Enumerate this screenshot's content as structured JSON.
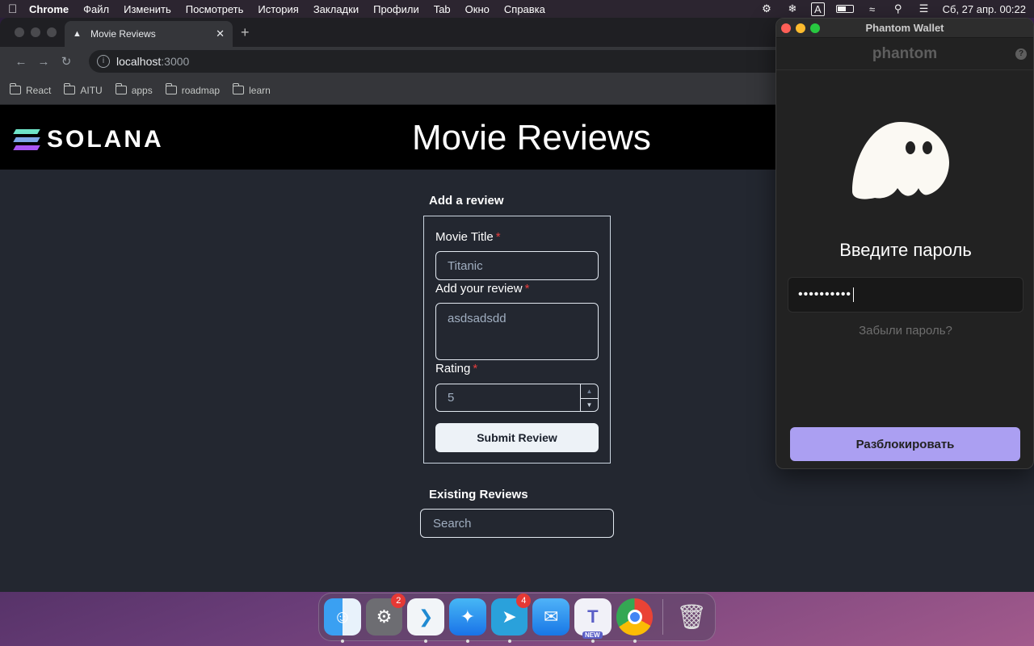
{
  "menubar": {
    "app": "Chrome",
    "items": [
      "Файл",
      "Изменить",
      "Посмотреть",
      "История",
      "Закладки",
      "Профили",
      "Tab",
      "Окно",
      "Справка"
    ],
    "input_indicator": "A",
    "datetime": "Сб, 27 апр.  00:22"
  },
  "browser": {
    "tab_title": "Movie Reviews",
    "url_host": "localhost",
    "url_port": ":3000",
    "bookmarks": [
      "React",
      "AITU",
      "apps",
      "roadmap",
      "learn"
    ]
  },
  "site": {
    "brand": "SOLANA",
    "title": "Movie Reviews",
    "form_heading": "Add a review",
    "fields": {
      "title_label": "Movie Title",
      "title_value": "Titanic",
      "review_label": "Add your review",
      "review_value": "asdsadsdd",
      "rating_label": "Rating",
      "rating_value": "5",
      "required_mark": "*"
    },
    "submit_label": "Submit Review",
    "existing_heading": "Existing Reviews",
    "search_placeholder": "Search"
  },
  "phantom": {
    "window_title": "Phantom Wallet",
    "brand": "phantom",
    "help": "?",
    "heading": "Введите пароль",
    "password_mask": "••••••••••",
    "forgot": "Забыли пароль?",
    "unlock": "Разблокировать",
    "accent": "#ab9ff2"
  },
  "dock": {
    "apps": [
      {
        "name": "Finder",
        "icon": "finder-icon"
      },
      {
        "name": "System Settings",
        "icon": "settings-icon",
        "badge": "2"
      },
      {
        "name": "VS Code",
        "icon": "vscode-icon"
      },
      {
        "name": "Safari",
        "icon": "safari-icon"
      },
      {
        "name": "Telegram",
        "icon": "telegram-icon",
        "badge": "4"
      },
      {
        "name": "Mail",
        "icon": "mail-icon"
      },
      {
        "name": "Teams",
        "icon": "teams-icon",
        "tag": "NEW"
      },
      {
        "name": "Chrome",
        "icon": "chrome-icon"
      },
      {
        "name": "Trash",
        "icon": "trash-icon"
      }
    ]
  }
}
